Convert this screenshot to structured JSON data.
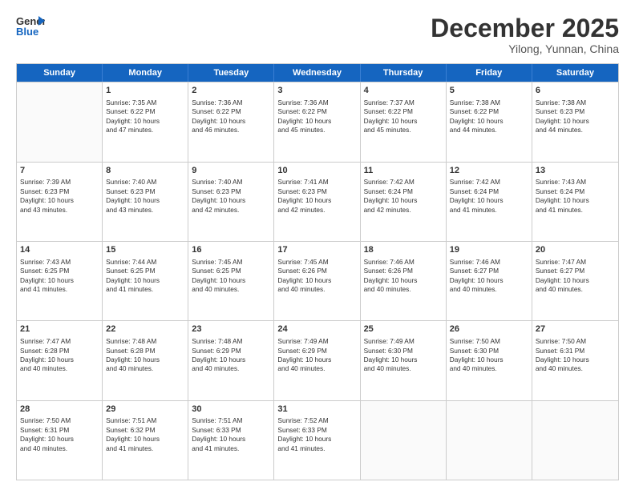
{
  "header": {
    "logo_line1": "General",
    "logo_line2": "Blue",
    "month": "December 2025",
    "location": "Yilong, Yunnan, China"
  },
  "weekdays": [
    "Sunday",
    "Monday",
    "Tuesday",
    "Wednesday",
    "Thursday",
    "Friday",
    "Saturday"
  ],
  "rows": [
    [
      {
        "day": "",
        "text": ""
      },
      {
        "day": "1",
        "text": "Sunrise: 7:35 AM\nSunset: 6:22 PM\nDaylight: 10 hours\nand 47 minutes."
      },
      {
        "day": "2",
        "text": "Sunrise: 7:36 AM\nSunset: 6:22 PM\nDaylight: 10 hours\nand 46 minutes."
      },
      {
        "day": "3",
        "text": "Sunrise: 7:36 AM\nSunset: 6:22 PM\nDaylight: 10 hours\nand 45 minutes."
      },
      {
        "day": "4",
        "text": "Sunrise: 7:37 AM\nSunset: 6:22 PM\nDaylight: 10 hours\nand 45 minutes."
      },
      {
        "day": "5",
        "text": "Sunrise: 7:38 AM\nSunset: 6:22 PM\nDaylight: 10 hours\nand 44 minutes."
      },
      {
        "day": "6",
        "text": "Sunrise: 7:38 AM\nSunset: 6:23 PM\nDaylight: 10 hours\nand 44 minutes."
      }
    ],
    [
      {
        "day": "7",
        "text": "Sunrise: 7:39 AM\nSunset: 6:23 PM\nDaylight: 10 hours\nand 43 minutes."
      },
      {
        "day": "8",
        "text": "Sunrise: 7:40 AM\nSunset: 6:23 PM\nDaylight: 10 hours\nand 43 minutes."
      },
      {
        "day": "9",
        "text": "Sunrise: 7:40 AM\nSunset: 6:23 PM\nDaylight: 10 hours\nand 42 minutes."
      },
      {
        "day": "10",
        "text": "Sunrise: 7:41 AM\nSunset: 6:23 PM\nDaylight: 10 hours\nand 42 minutes."
      },
      {
        "day": "11",
        "text": "Sunrise: 7:42 AM\nSunset: 6:24 PM\nDaylight: 10 hours\nand 42 minutes."
      },
      {
        "day": "12",
        "text": "Sunrise: 7:42 AM\nSunset: 6:24 PM\nDaylight: 10 hours\nand 41 minutes."
      },
      {
        "day": "13",
        "text": "Sunrise: 7:43 AM\nSunset: 6:24 PM\nDaylight: 10 hours\nand 41 minutes."
      }
    ],
    [
      {
        "day": "14",
        "text": "Sunrise: 7:43 AM\nSunset: 6:25 PM\nDaylight: 10 hours\nand 41 minutes."
      },
      {
        "day": "15",
        "text": "Sunrise: 7:44 AM\nSunset: 6:25 PM\nDaylight: 10 hours\nand 41 minutes."
      },
      {
        "day": "16",
        "text": "Sunrise: 7:45 AM\nSunset: 6:25 PM\nDaylight: 10 hours\nand 40 minutes."
      },
      {
        "day": "17",
        "text": "Sunrise: 7:45 AM\nSunset: 6:26 PM\nDaylight: 10 hours\nand 40 minutes."
      },
      {
        "day": "18",
        "text": "Sunrise: 7:46 AM\nSunset: 6:26 PM\nDaylight: 10 hours\nand 40 minutes."
      },
      {
        "day": "19",
        "text": "Sunrise: 7:46 AM\nSunset: 6:27 PM\nDaylight: 10 hours\nand 40 minutes."
      },
      {
        "day": "20",
        "text": "Sunrise: 7:47 AM\nSunset: 6:27 PM\nDaylight: 10 hours\nand 40 minutes."
      }
    ],
    [
      {
        "day": "21",
        "text": "Sunrise: 7:47 AM\nSunset: 6:28 PM\nDaylight: 10 hours\nand 40 minutes."
      },
      {
        "day": "22",
        "text": "Sunrise: 7:48 AM\nSunset: 6:28 PM\nDaylight: 10 hours\nand 40 minutes."
      },
      {
        "day": "23",
        "text": "Sunrise: 7:48 AM\nSunset: 6:29 PM\nDaylight: 10 hours\nand 40 minutes."
      },
      {
        "day": "24",
        "text": "Sunrise: 7:49 AM\nSunset: 6:29 PM\nDaylight: 10 hours\nand 40 minutes."
      },
      {
        "day": "25",
        "text": "Sunrise: 7:49 AM\nSunset: 6:30 PM\nDaylight: 10 hours\nand 40 minutes."
      },
      {
        "day": "26",
        "text": "Sunrise: 7:50 AM\nSunset: 6:30 PM\nDaylight: 10 hours\nand 40 minutes."
      },
      {
        "day": "27",
        "text": "Sunrise: 7:50 AM\nSunset: 6:31 PM\nDaylight: 10 hours\nand 40 minutes."
      }
    ],
    [
      {
        "day": "28",
        "text": "Sunrise: 7:50 AM\nSunset: 6:31 PM\nDaylight: 10 hours\nand 40 minutes."
      },
      {
        "day": "29",
        "text": "Sunrise: 7:51 AM\nSunset: 6:32 PM\nDaylight: 10 hours\nand 41 minutes."
      },
      {
        "day": "30",
        "text": "Sunrise: 7:51 AM\nSunset: 6:33 PM\nDaylight: 10 hours\nand 41 minutes."
      },
      {
        "day": "31",
        "text": "Sunrise: 7:52 AM\nSunset: 6:33 PM\nDaylight: 10 hours\nand 41 minutes."
      },
      {
        "day": "",
        "text": ""
      },
      {
        "day": "",
        "text": ""
      },
      {
        "day": "",
        "text": ""
      }
    ]
  ]
}
